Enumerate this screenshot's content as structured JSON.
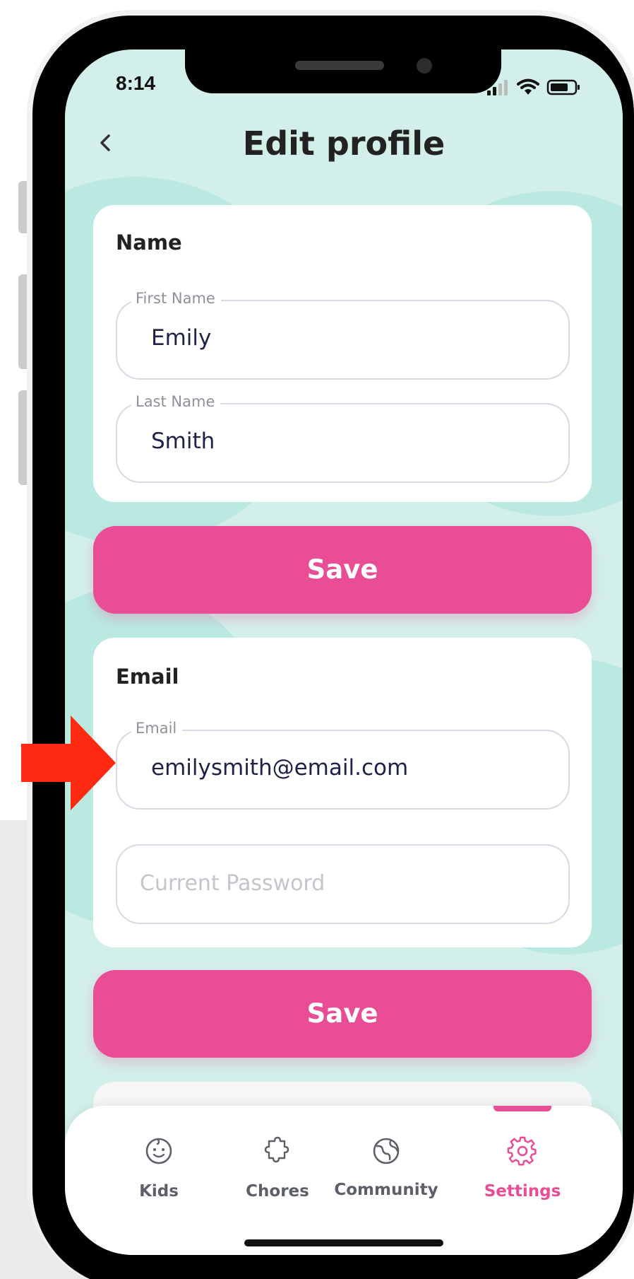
{
  "status_bar": {
    "time": "8:14"
  },
  "header": {
    "back_icon": "chevron-left-icon",
    "title": "Edit profile"
  },
  "name_card": {
    "heading": "Name",
    "first_name": {
      "label": "First Name",
      "value": "Emily"
    },
    "last_name": {
      "label": "Last Name",
      "value": "Smith"
    }
  },
  "name_save": {
    "label": "Save"
  },
  "email_card": {
    "heading": "Email",
    "email": {
      "label": "Email",
      "value": "emilysmith@email.com"
    },
    "current_password": {
      "placeholder": "Current Password",
      "value": ""
    }
  },
  "email_save": {
    "label": "Save"
  },
  "tabs": [
    {
      "label": "Kids",
      "icon": "baby-face-icon",
      "active": false
    },
    {
      "label": "Chores",
      "icon": "puzzle-icon",
      "active": false
    },
    {
      "label": "Community",
      "icon": "globe-icon",
      "active": false
    },
    {
      "label": "Settings",
      "icon": "gear-icon",
      "active": true
    }
  ],
  "colors": {
    "accent": "#e84d95",
    "background": "#d3efea",
    "annotation_arrow": "#ff2a12"
  },
  "annotation": {
    "icon": "red-arrow-icon",
    "points_to": "email-field"
  }
}
